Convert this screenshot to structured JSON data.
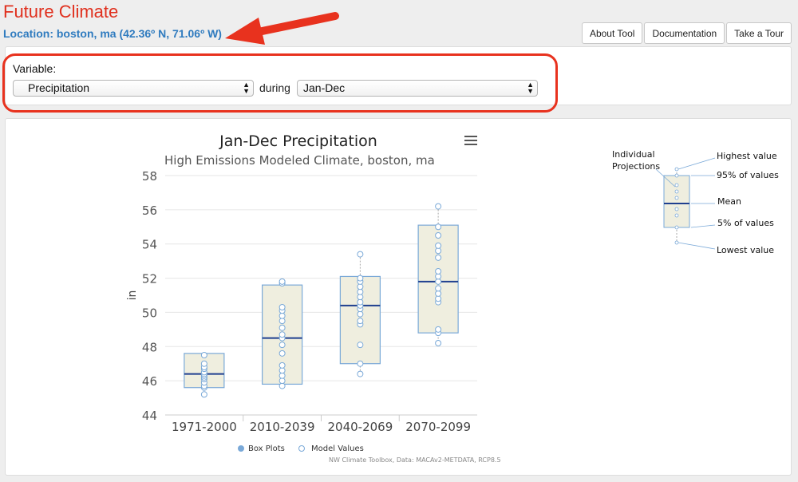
{
  "header": {
    "title": "Future Climate",
    "location": "Location: boston, ma (42.36º N, 71.06º W)",
    "buttons": [
      "About Tool",
      "Documentation",
      "Take a Tour"
    ]
  },
  "variable_panel": {
    "label": "Variable:",
    "variable_selected": "Precipitation",
    "during_text": "during",
    "season_selected": "Jan-Dec"
  },
  "colors": {
    "title": "#e0301e",
    "location": "#2f7bbf",
    "annotation": "#e8321e",
    "box_fill": "#efeedf",
    "box_stroke": "#7aa9d8",
    "mean_line": "#1f3f8f"
  },
  "chart_data": {
    "type": "boxplot",
    "title": "Jan-Dec Precipitation",
    "subtitle": "High Emissions Modeled Climate, boston, ma",
    "ylabel": "in",
    "ylim": [
      44,
      58
    ],
    "yticks": [
      44,
      46,
      48,
      50,
      52,
      54,
      56,
      58
    ],
    "categories": [
      "1971-2000",
      "2010-2039",
      "2040-2069",
      "2070-2099"
    ],
    "boxes": [
      {
        "low": 45.2,
        "q05": 45.6,
        "mean": 46.4,
        "q95": 47.6,
        "high": 47.6,
        "points": [
          45.2,
          45.6,
          45.7,
          45.9,
          46.1,
          46.2,
          46.3,
          46.4,
          46.5,
          46.7,
          46.8,
          47.0,
          47.5
        ]
      },
      {
        "low": 45.7,
        "q05": 45.8,
        "mean": 48.5,
        "q95": 51.6,
        "high": 51.8,
        "points": [
          45.7,
          46.0,
          46.3,
          46.6,
          46.9,
          47.6,
          48.1,
          48.5,
          48.7,
          49.1,
          49.5,
          49.8,
          50.1,
          50.3,
          51.7,
          51.8
        ]
      },
      {
        "low": 46.4,
        "q05": 47.0,
        "mean": 50.4,
        "q95": 52.1,
        "high": 53.4,
        "points": [
          46.4,
          47.0,
          48.1,
          49.3,
          49.5,
          49.9,
          50.2,
          50.4,
          50.6,
          50.9,
          51.2,
          51.5,
          51.8,
          52.0,
          53.4
        ]
      },
      {
        "low": 48.2,
        "q05": 48.8,
        "mean": 51.8,
        "q95": 55.1,
        "high": 56.2,
        "points": [
          48.2,
          48.8,
          49.0,
          50.6,
          50.8,
          51.1,
          51.4,
          51.8,
          52.1,
          52.4,
          53.2,
          53.6,
          53.9,
          54.5,
          55.0,
          56.2
        ]
      }
    ],
    "legend": [
      "Box Plots",
      "Model Values"
    ],
    "credits": "NW Climate Toolbox, Data: MACAv2-METDATA, RCP8.5",
    "grid": true
  },
  "key_diagram": {
    "labels": {
      "projections": "Individual Projections",
      "highest": "Highest value",
      "p95": "95% of values",
      "mean": "Mean",
      "p05": "5% of values",
      "lowest": "Lowest value"
    }
  }
}
